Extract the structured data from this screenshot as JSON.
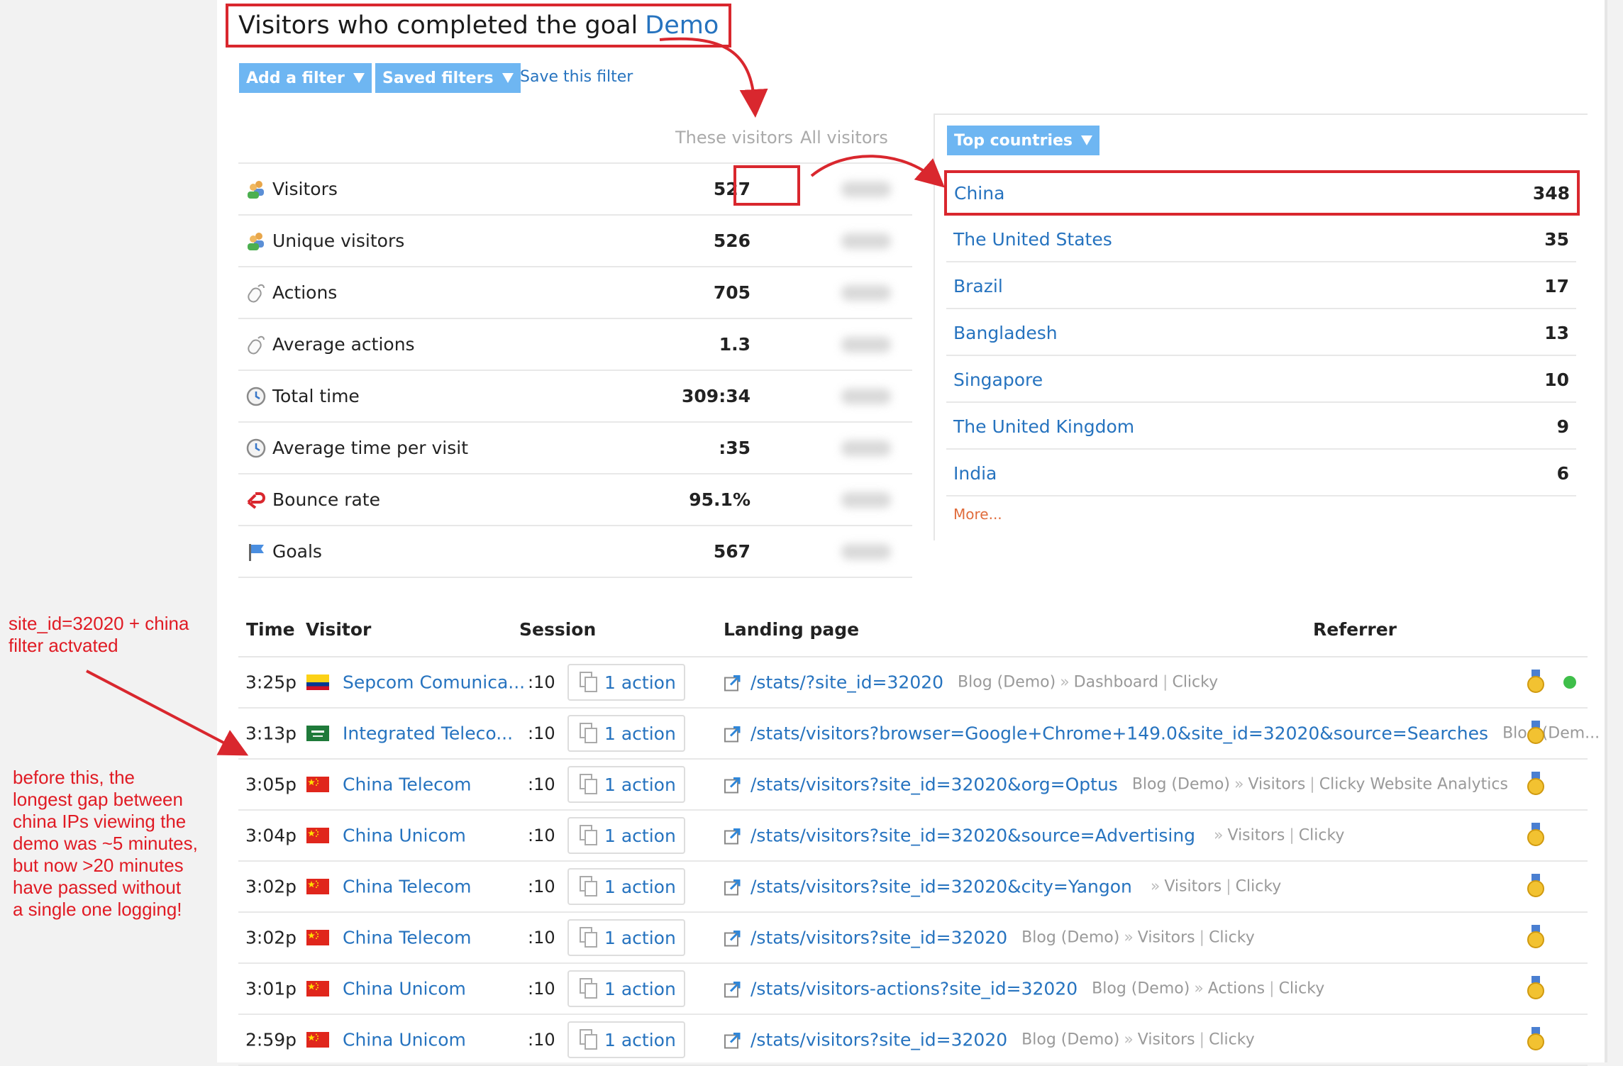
{
  "header": {
    "title_prefix": "Visitors who completed the goal",
    "goal_name": "Demo",
    "add_filter": "Add a filter",
    "saved_filters": "Saved filters",
    "save_filter": "Save this filter"
  },
  "stats": {
    "col_these": "These visitors",
    "col_all": "All visitors",
    "rows": [
      {
        "label": "Visitors",
        "value": "527",
        "icon": "visitors-icon"
      },
      {
        "label": "Unique visitors",
        "value": "526",
        "icon": "visitors-icon"
      },
      {
        "label": "Actions",
        "value": "705",
        "icon": "mouse-icon"
      },
      {
        "label": "Average actions",
        "value": "1.3",
        "icon": "mouse-icon"
      },
      {
        "label": "Total time",
        "value": "309:34",
        "icon": "clock-icon"
      },
      {
        "label": "Average time per visit",
        "value": ":35",
        "icon": "clock-icon"
      },
      {
        "label": "Bounce rate",
        "value": "95.1%",
        "icon": "bounce-icon"
      },
      {
        "label": "Goals",
        "value": "567",
        "icon": "goal-flag-icon"
      }
    ]
  },
  "countries": {
    "dropdown": "Top countries",
    "rows": [
      {
        "name": "China",
        "value": "348"
      },
      {
        "name": "The United States",
        "value": "35"
      },
      {
        "name": "Brazil",
        "value": "17"
      },
      {
        "name": "Bangladesh",
        "value": "13"
      },
      {
        "name": "Singapore",
        "value": "10"
      },
      {
        "name": "The United Kingdom",
        "value": "9"
      },
      {
        "name": "India",
        "value": "6"
      }
    ],
    "more": "More..."
  },
  "table": {
    "headers": {
      "time": "Time",
      "visitor": "Visitor",
      "session": "Session",
      "landing": "Landing page",
      "referrer": "Referrer"
    },
    "rows": [
      {
        "time": "3:25p",
        "flag": "colombia",
        "visitor": "Sepcom Comunica...",
        "session": ":10",
        "action": "1 action",
        "landing": "/stats/?site_id=32020",
        "ref1": "Blog (Demo)",
        "ref2": "Dashboard",
        "ref3": "Clicky",
        "online": true
      },
      {
        "time": "3:13p",
        "flag": "saudi",
        "visitor": "Integrated Teleco...",
        "session": ":10",
        "action": "1 action",
        "landing": "/stats/visitors?browser=Google+Chrome+149.0&site_id=32020&source=Searches",
        "ref1": "Blog (Dem...",
        "ref2": "",
        "ref3": ""
      },
      {
        "time": "3:05p",
        "flag": "china",
        "visitor": "China Telecom",
        "session": ":10",
        "action": "1 action",
        "landing": "/stats/visitors?site_id=32020&org=Optus",
        "ref1": "Blog (Demo)",
        "ref2": "Visitors",
        "ref3": "Clicky Website Analytics"
      },
      {
        "time": "3:04p",
        "flag": "china",
        "visitor": "China Unicom",
        "session": ":10",
        "action": "1 action",
        "landing": "/stats/visitors?site_id=32020&source=Advertising",
        "ref1": "",
        "ref2": "Visitors",
        "ref3": "Clicky"
      },
      {
        "time": "3:02p",
        "flag": "china",
        "visitor": "China Telecom",
        "session": ":10",
        "action": "1 action",
        "landing": "/stats/visitors?site_id=32020&city=Yangon",
        "ref1": "",
        "ref2": "Visitors",
        "ref3": "Clicky"
      },
      {
        "time": "3:02p",
        "flag": "china",
        "visitor": "China Telecom",
        "session": ":10",
        "action": "1 action",
        "landing": "/stats/visitors?site_id=32020",
        "ref1": "Blog (Demo)",
        "ref2": "Visitors",
        "ref3": "Clicky"
      },
      {
        "time": "3:01p",
        "flag": "china",
        "visitor": "China Unicom",
        "session": ":10",
        "action": "1 action",
        "landing": "/stats/visitors-actions?site_id=32020",
        "ref1": "Blog (Demo)",
        "ref2": "Actions",
        "ref3": "Clicky"
      },
      {
        "time": "2:59p",
        "flag": "china",
        "visitor": "China Unicom",
        "session": ":10",
        "action": "1 action",
        "landing": "/stats/visitors?site_id=32020",
        "ref1": "Blog (Demo)",
        "ref2": "Visitors",
        "ref3": "Clicky"
      }
    ]
  },
  "annotations": {
    "note1": [
      "site_id=32020 + china",
      "filter actvated"
    ],
    "note2": [
      "before this, the",
      "longest gap between",
      "china IPs viewing the",
      "demo was ~5 minutes,",
      "but now >20 minutes",
      "have passed without",
      "a single one logging!"
    ]
  },
  "colors": {
    "link": "#2673bf",
    "highlight": "#d9272e",
    "button": "#6eb6f2",
    "annotation": "#e01b24"
  }
}
